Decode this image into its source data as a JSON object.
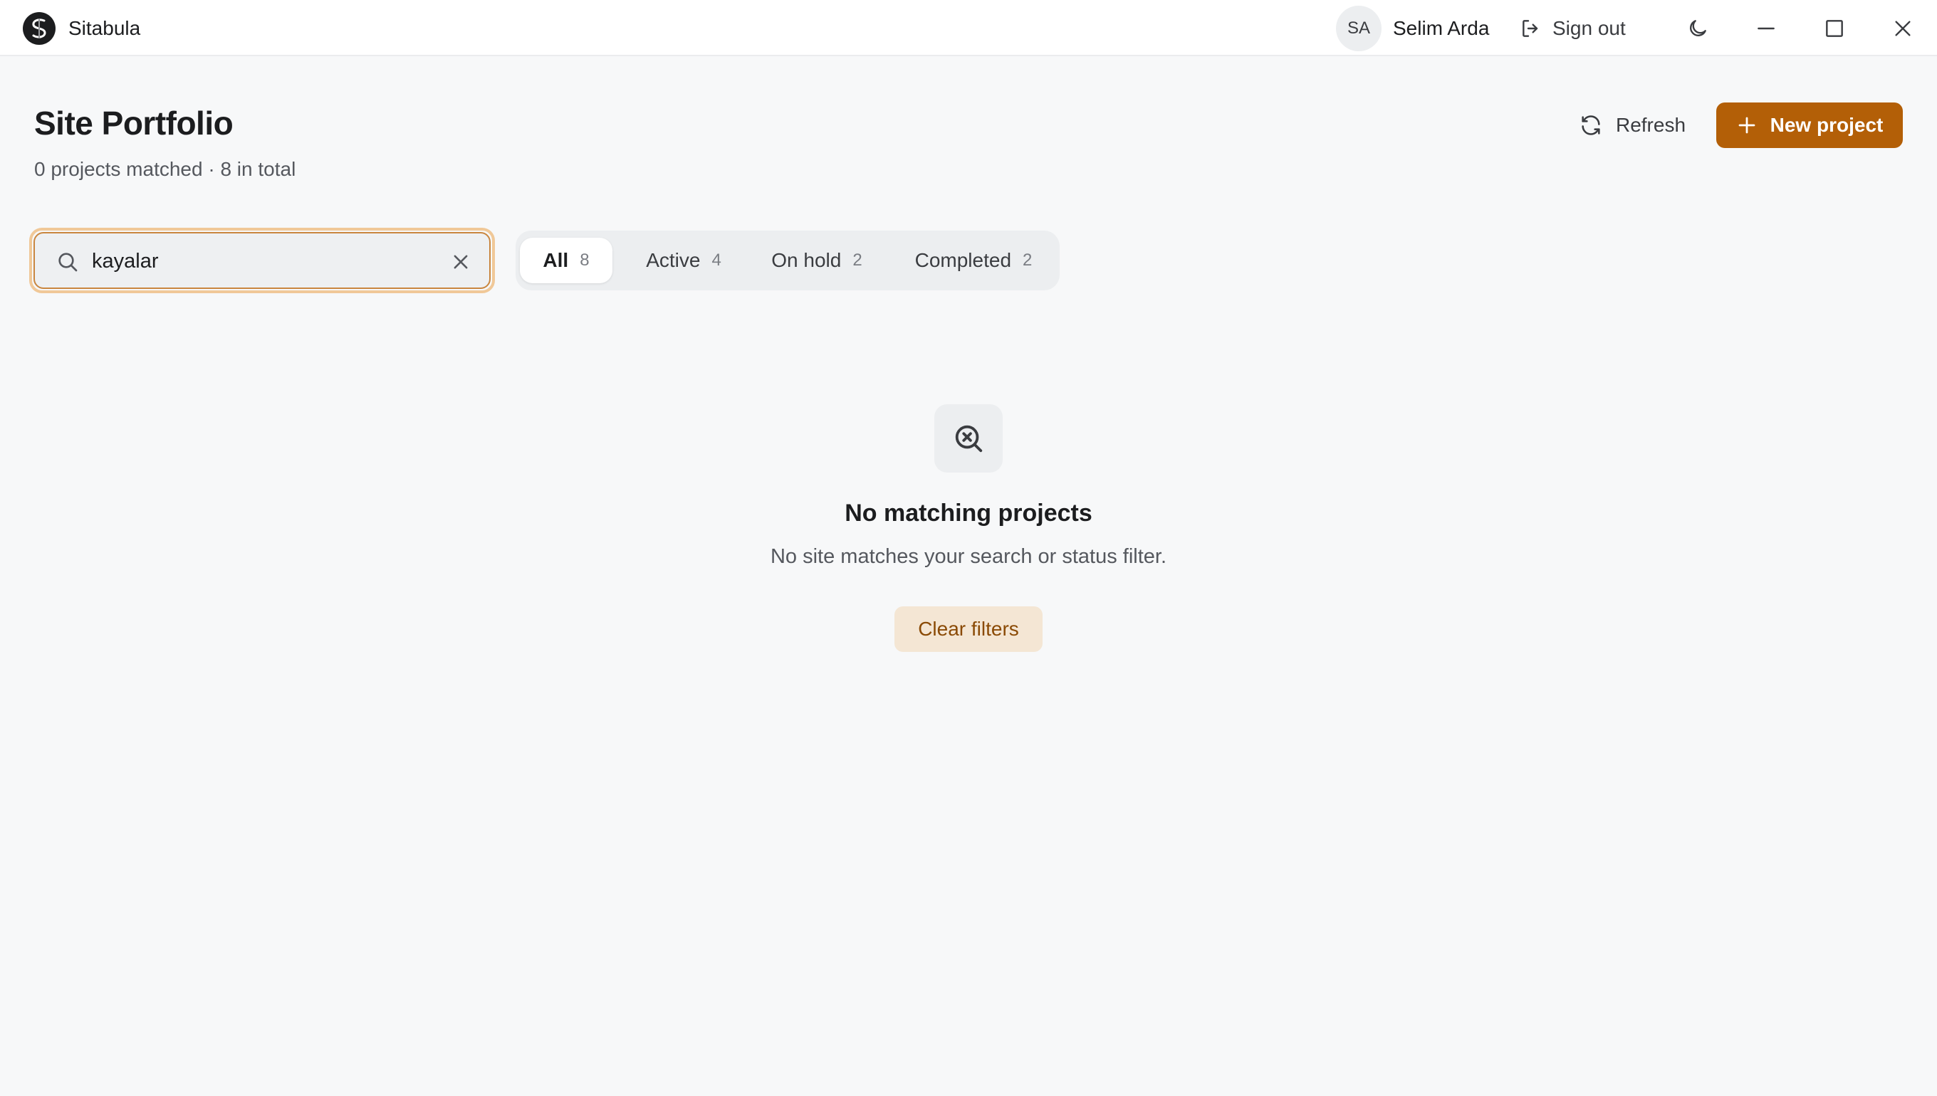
{
  "app": {
    "name": "Sitabula"
  },
  "user": {
    "initials": "SA",
    "name": "Selim Arda"
  },
  "titlebar": {
    "sign_out_label": "Sign out"
  },
  "header": {
    "title": "Site Portfolio",
    "subtitle": "0 projects matched · 8 in total",
    "refresh_label": "Refresh",
    "new_project_label": "New project"
  },
  "search": {
    "value": "kayalar"
  },
  "filters": [
    {
      "label": "All",
      "count": "8",
      "selected": true
    },
    {
      "label": "Active",
      "count": "4",
      "selected": false
    },
    {
      "label": "On hold",
      "count": "2",
      "selected": false
    },
    {
      "label": "Completed",
      "count": "2",
      "selected": false
    }
  ],
  "empty_state": {
    "title": "No matching projects",
    "description": "No site matches your search or status filter.",
    "clear_label": "Clear filters"
  },
  "icons": {
    "logo": "sitabula-logo-icon",
    "sign_out": "sign-out-icon",
    "theme": "moon-icon",
    "minimize": "minimize-icon",
    "maximize": "maximize-icon",
    "close": "close-icon",
    "refresh": "refresh-icon",
    "new": "plus-icon",
    "search": "search-icon",
    "clear": "clear-icon",
    "empty": "search-x-icon"
  },
  "colors": {
    "accent": "#b35f07",
    "accent_soft": "#f4e6d4",
    "background": "#f7f8f9",
    "focus_ring": "#f0c898"
  }
}
